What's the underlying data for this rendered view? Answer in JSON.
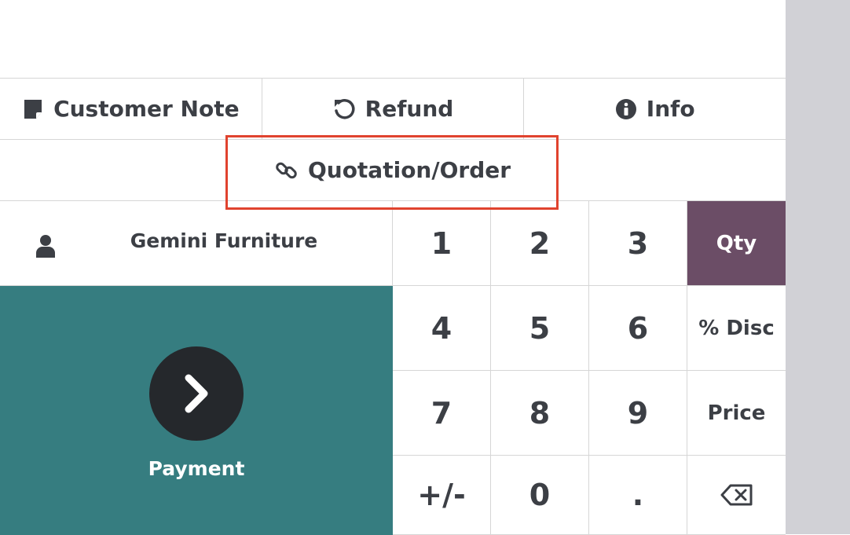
{
  "controls": {
    "customer_note": "Customer Note",
    "refund": "Refund",
    "info": "Info",
    "quotation_order": "Quotation/Order"
  },
  "customer": {
    "name": "Gemini Furniture"
  },
  "payment": {
    "label": "Payment"
  },
  "numpad": {
    "k1": "1",
    "k2": "2",
    "k3": "3",
    "qty": "Qty",
    "k4": "4",
    "k5": "5",
    "k6": "6",
    "disc": "% Disc",
    "k7": "7",
    "k8": "8",
    "k9": "9",
    "price": "Price",
    "sign": "+/-",
    "k0": "0",
    "dot": ".",
    "active_mode": "Qty"
  },
  "colors": {
    "payment_bg": "#367d80",
    "active_mode_bg": "#6b4d66",
    "highlight_border": "#e0432e"
  },
  "icons": {
    "customer_note": "sticky-note-icon",
    "refund": "undo-icon",
    "info": "info-circle-icon",
    "quotation_order": "link-icon",
    "customer": "user-icon",
    "payment": "chevron-right-icon",
    "backspace": "backspace-icon"
  }
}
